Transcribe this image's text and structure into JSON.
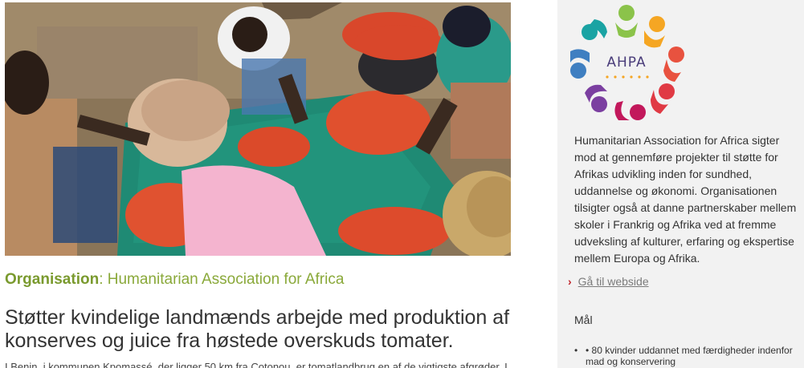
{
  "organisation": {
    "label": "Organisation",
    "separator": ": ",
    "name": "Humanitarian Association for Africa"
  },
  "headline": "Støtter kvindelige landmænds arbejde med produktion af konserves og juice fra høstede overskuds tomater.",
  "intro": "I Benin, i kommunen Kpomassé, der ligger 50 km fra Cotonou, er tomatlandbrug en af de vigtigste afgrøder. I",
  "sidebar": {
    "logo_text": "AHPA",
    "description": "Humanitarian Association for Africa sigter mod at gennemføre projekter til støtte for Afrikas udvikling inden for sundhed, uddannelse og økonomi. Organisationen tilsigter også at danne partnerskaber mellem skoler i Frankrig og Afrika ved at fremme udveksling af kulturer, erfaring og ekspertise mellem Europa og Afrika.",
    "link_chevron": "›",
    "link_label": "Gå til webside",
    "goals_title": "Mål",
    "goals": [
      "• 80 kvinder uddannet med færdigheder indenfor mad og konservering"
    ]
  },
  "colors": {
    "organisation_green": "#8aa93a",
    "link_chevron_red": "#c1272d",
    "sidebar_bg": "#f2f2f2",
    "logo_figures": [
      "#8bc34a",
      "#f5a623",
      "#e8523f",
      "#c2185b",
      "#7b3fa0",
      "#3f7fc1",
      "#1aa3a3",
      "#cddc39"
    ]
  }
}
